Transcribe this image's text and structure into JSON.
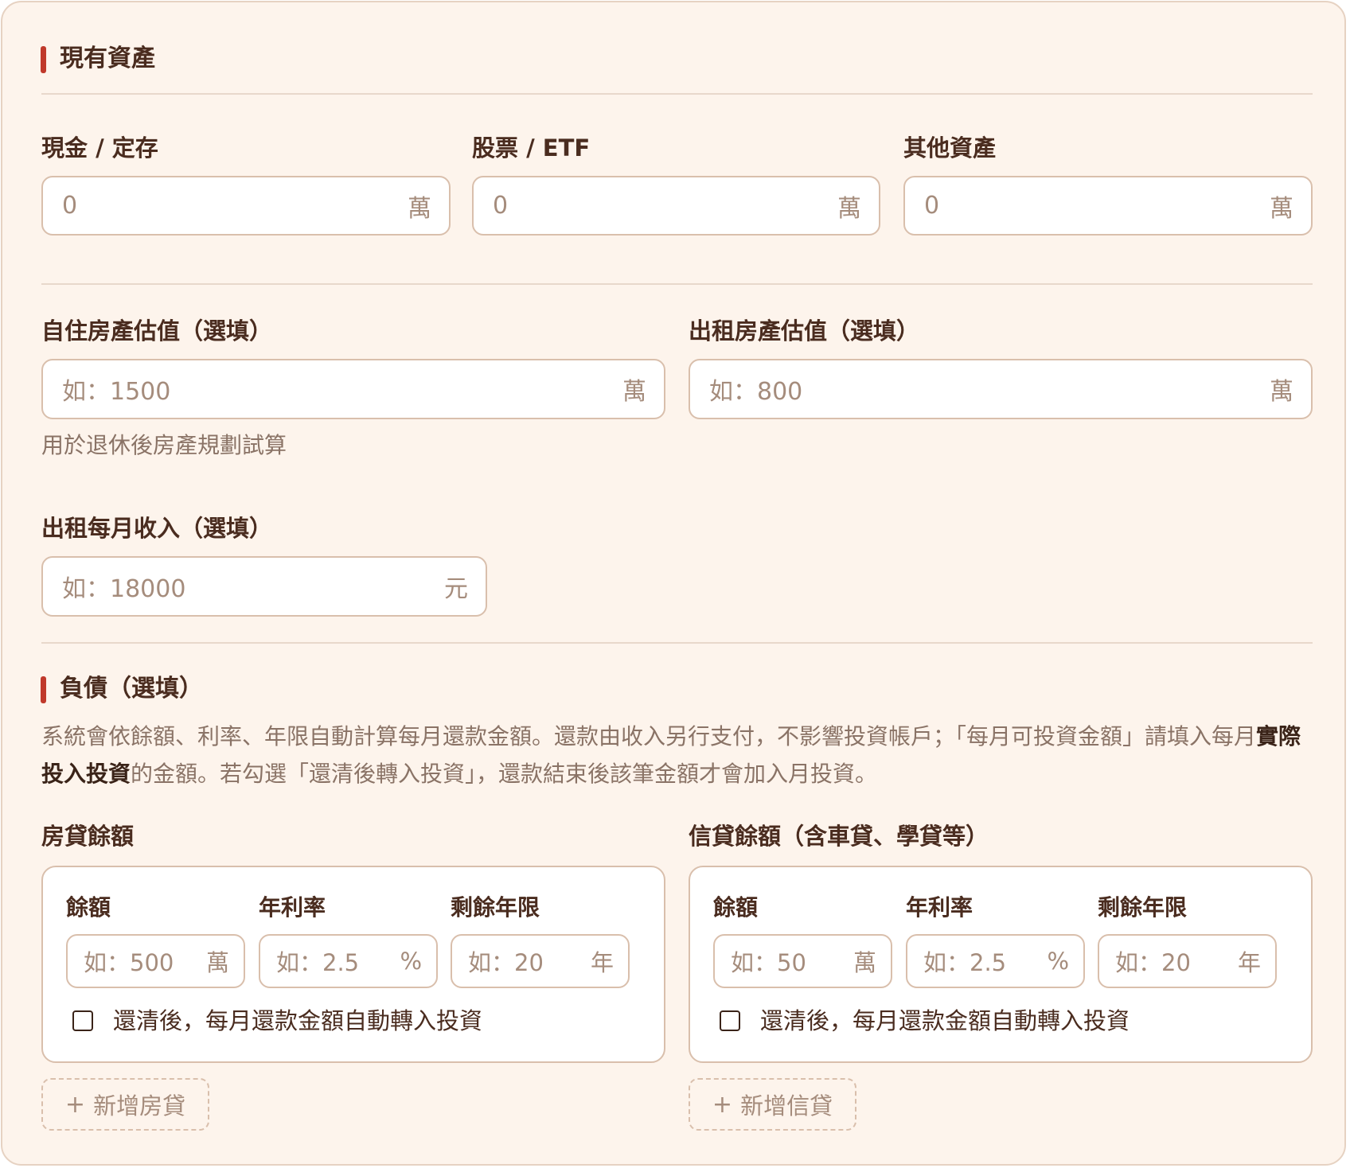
{
  "assets": {
    "title": "現有資產",
    "cash": {
      "label": "現金 / 定存",
      "value": "0",
      "unit": "萬"
    },
    "stocks": {
      "label": "股票 / ETF",
      "value": "0",
      "unit": "萬"
    },
    "other": {
      "label": "其他資產",
      "value": "0",
      "unit": "萬"
    },
    "home": {
      "label": "自住房產估值（選填）",
      "placeholder": "如：1500",
      "unit": "萬",
      "hint": "用於退休後房產規劃試算"
    },
    "rental": {
      "label": "出租房產估值（選填）",
      "placeholder": "如：800",
      "unit": "萬"
    },
    "rental_income": {
      "label": "出租每月收入（選填）",
      "placeholder": "如：18000",
      "unit": "元"
    }
  },
  "liabilities": {
    "title": "負債（選填）",
    "desc_part1": "系統會依餘額、利率、年限自動計算每月還款金額。還款由收入另行支付，不影響投資帳戶；「每月可投資金額」請填入每月",
    "desc_bold": "實際投入投資",
    "desc_part2": "的金額。若勾選「還清後轉入投資」，還款結束後該筆金額才會加入月投資。",
    "mortgage": {
      "label": "房貸餘額",
      "balance_label": "餘額",
      "balance_placeholder": "如：500",
      "balance_unit": "萬",
      "rate_label": "年利率",
      "rate_placeholder": "如：2.5",
      "rate_unit": "%",
      "years_label": "剩餘年限",
      "years_placeholder": "如：20",
      "years_unit": "年",
      "checkbox_label": "還清後，每月還款金額自動轉入投資",
      "add_label": "新增房貸"
    },
    "credit": {
      "label": "信貸餘額（含車貸、學貸等）",
      "balance_label": "餘額",
      "balance_placeholder": "如：50",
      "balance_unit": "萬",
      "rate_label": "年利率",
      "rate_placeholder": "如：2.5",
      "rate_unit": "%",
      "years_label": "剩餘年限",
      "years_placeholder": "如：20",
      "years_unit": "年",
      "checkbox_label": "還清後，每月還款金額自動轉入投資",
      "add_label": "新增信貸"
    },
    "plus_glyph": "+"
  }
}
